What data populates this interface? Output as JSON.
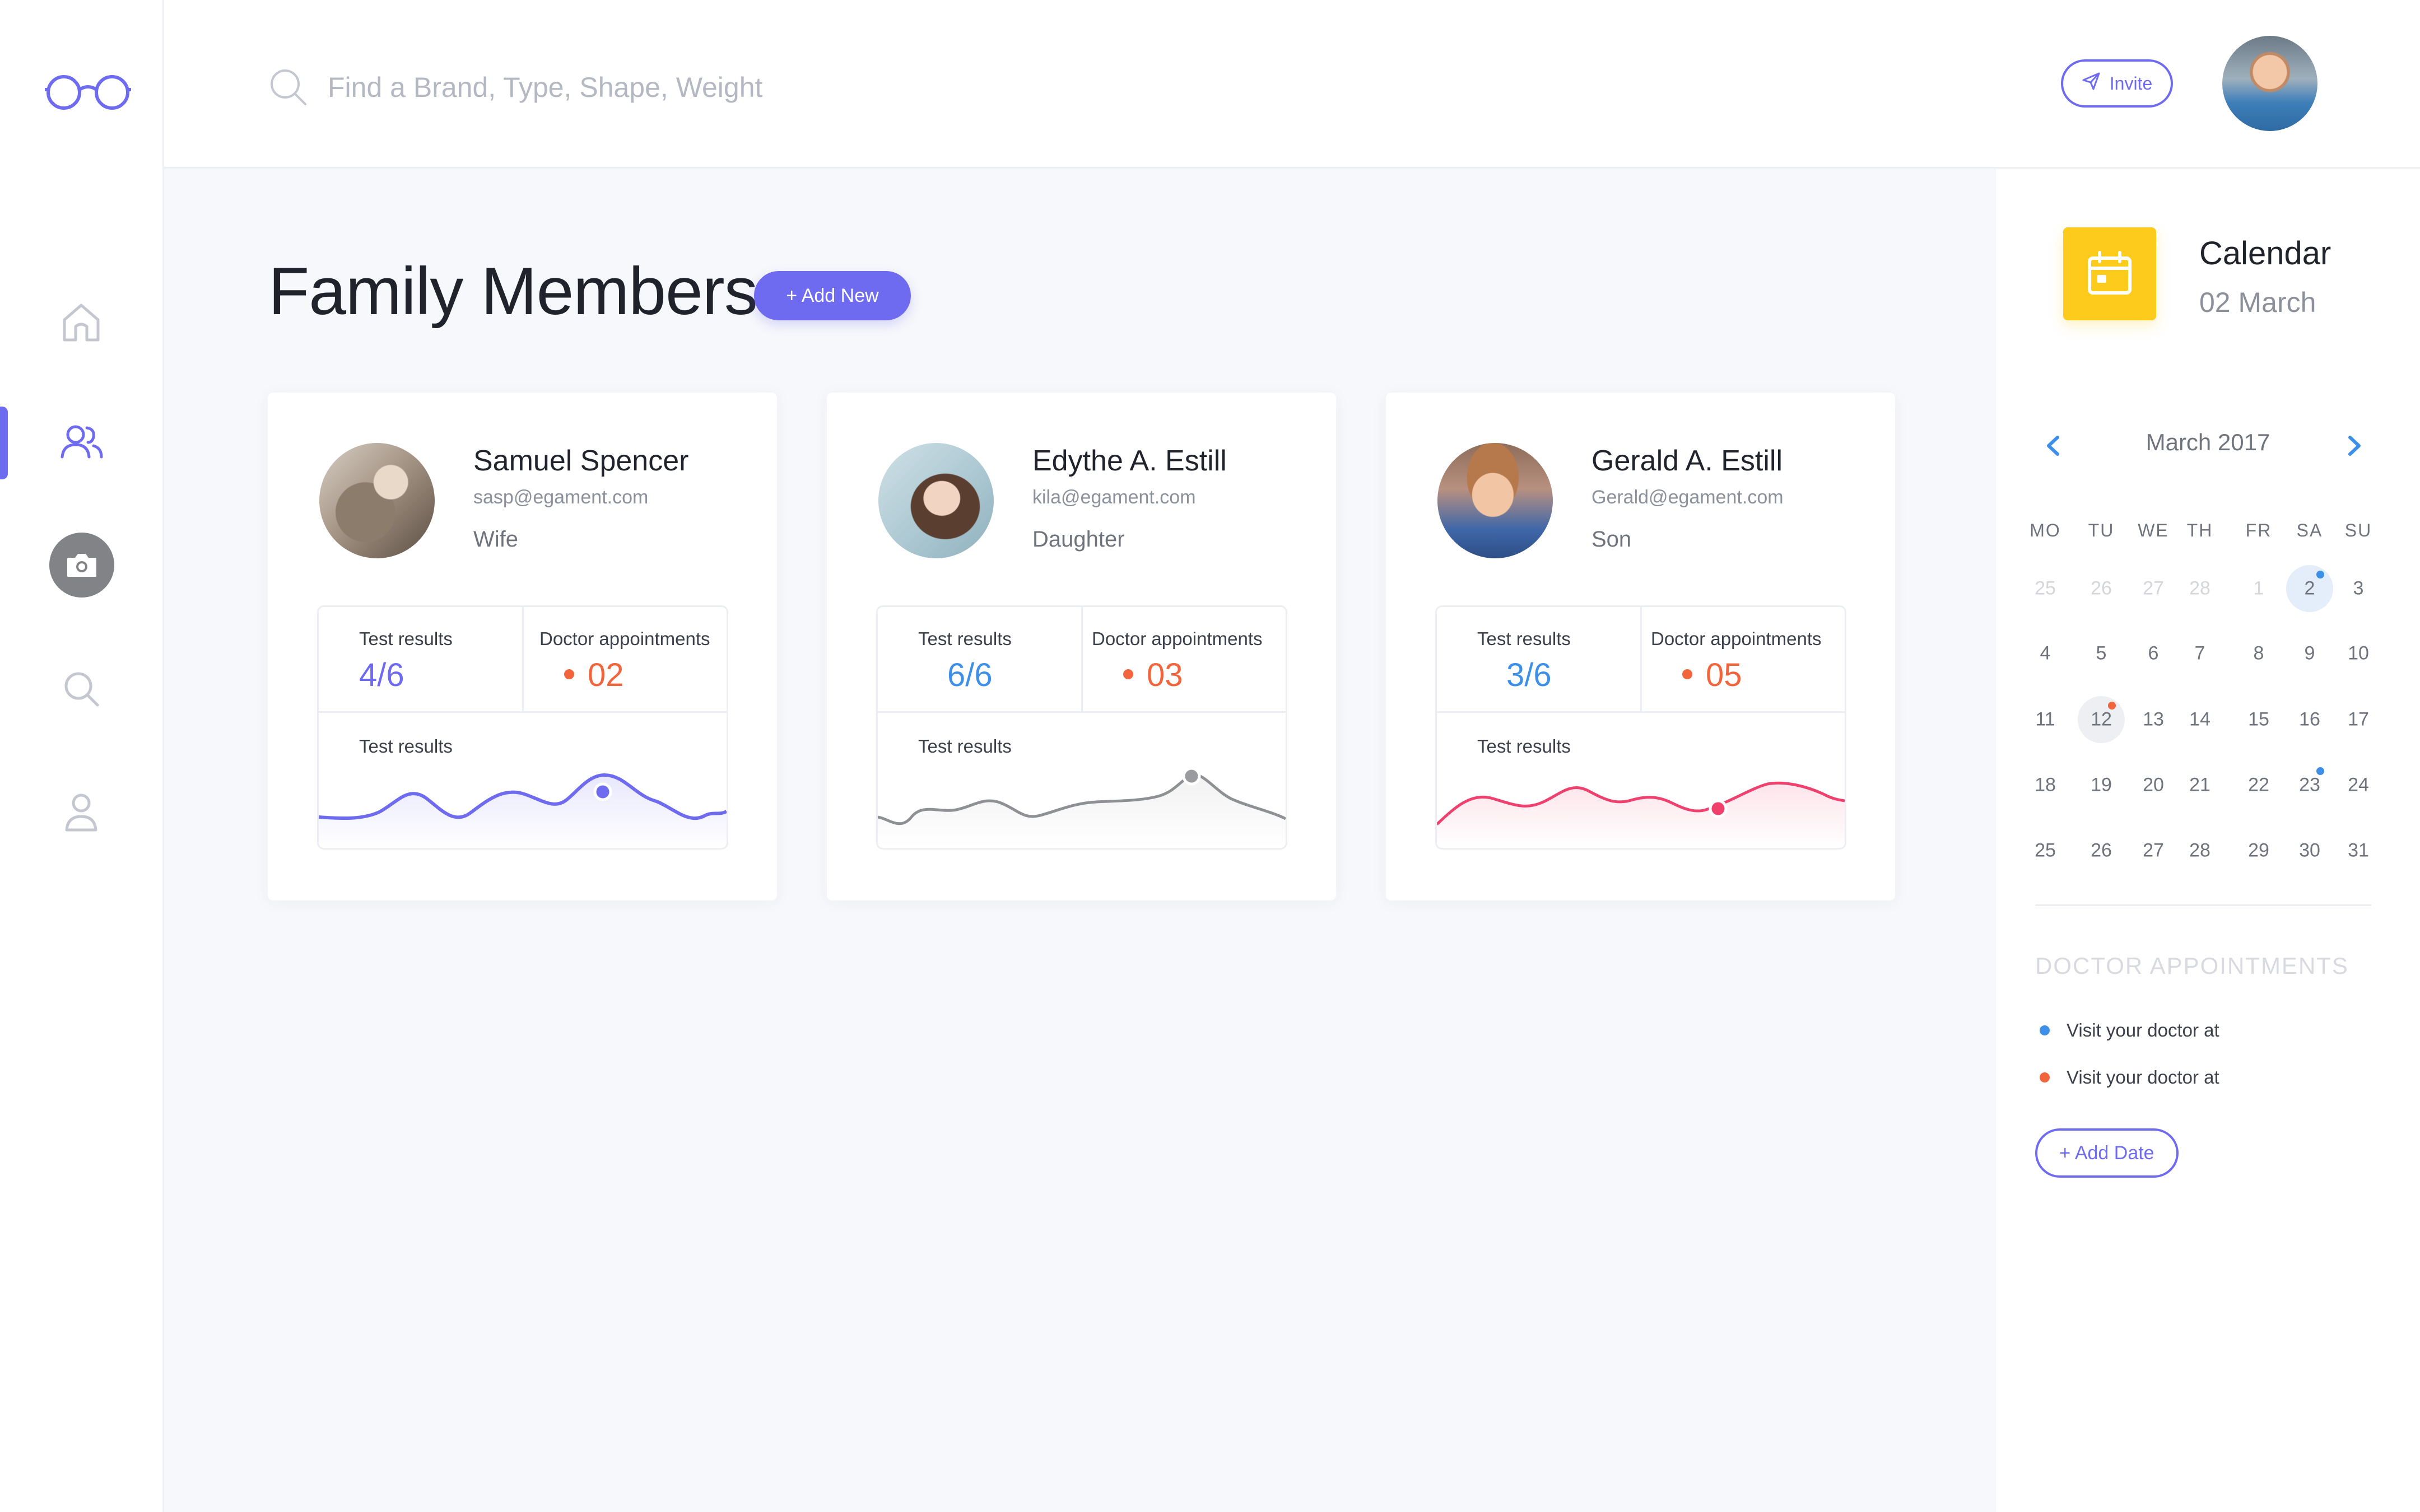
{
  "header": {
    "search_placeholder": "Find a Brand, Type, Shape, Weight",
    "invite_label": "Invite"
  },
  "main": {
    "title": "Family Members",
    "add_new_label": "+ Add New",
    "members": [
      {
        "name": "Samuel Spencer",
        "email": "sasp@egament.com",
        "relation": "Wife",
        "test_results_label": "Test results",
        "test_results_value": "4/6",
        "appointments_label": "Doctor appointments",
        "appointments_value": "02",
        "chart_label": "Test results",
        "chart_color": "#6e6bf0"
      },
      {
        "name": "Edythe A. Estill",
        "email": "kila@egament.com",
        "relation": "Daughter",
        "test_results_label": "Test results",
        "test_results_value": "6/6",
        "appointments_label": "Doctor appointments",
        "appointments_value": "03",
        "chart_label": "Test results",
        "chart_color": "#8f9094"
      },
      {
        "name": "Gerald A. Estill",
        "email": "Gerald@egament.com",
        "relation": "Son",
        "test_results_label": "Test results",
        "test_results_value": "3/6",
        "appointments_label": "Doctor appointments",
        "appointments_value": "05",
        "chart_label": "Test results",
        "chart_color": "#f0406e"
      }
    ]
  },
  "calendar": {
    "title": "Calendar",
    "date": "02 March",
    "month": "March 2017",
    "weekdays": [
      "MO",
      "TU",
      "WE",
      "TH",
      "FR",
      "SA",
      "SU"
    ],
    "weeks": [
      [
        "25",
        "26",
        "27",
        "28",
        "1",
        "2",
        "3"
      ],
      [
        "4",
        "5",
        "6",
        "7",
        "8",
        "9",
        "10"
      ],
      [
        "11",
        "12",
        "13",
        "14",
        "15",
        "16",
        "17"
      ],
      [
        "18",
        "19",
        "20",
        "21",
        "22",
        "23",
        "24"
      ],
      [
        "25",
        "26",
        "27",
        "28",
        "29",
        "30",
        "31"
      ]
    ],
    "appointments_title": "DOCTOR APPOINTMENTS",
    "appointments": [
      {
        "text": "Visit your doctor at",
        "color": "#3d8fe8"
      },
      {
        "text": "Visit your doctor at",
        "color": "#f2643c"
      }
    ],
    "add_date_label": "+ Add Date"
  },
  "colors": {
    "accent": "#6e6bf0",
    "blue": "#3d8fe8",
    "orange": "#f2643c",
    "yellow": "#fccb1b"
  }
}
